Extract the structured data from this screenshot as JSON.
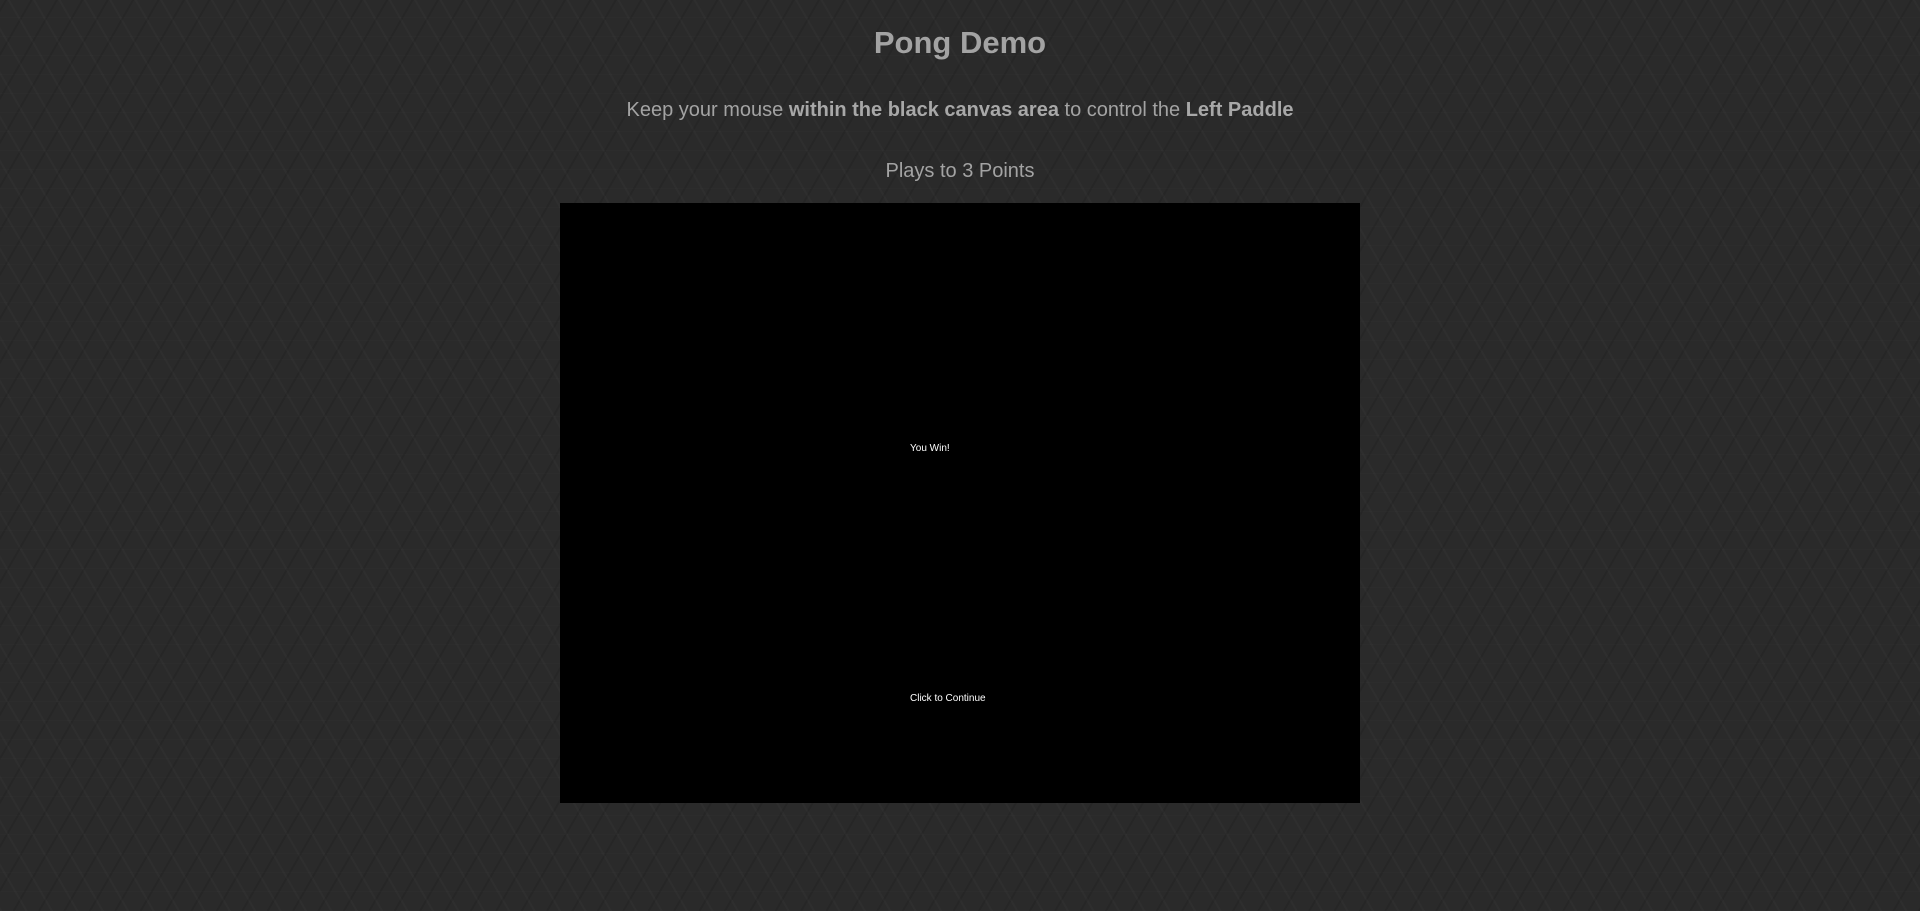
{
  "page": {
    "title": "Pong Demo",
    "instructions": {
      "part1": "Keep your mouse ",
      "emphasis1": "within the black canvas area",
      "part2": " to control the ",
      "emphasis2": "Left Paddle"
    },
    "points_info": "Plays to 3 Points"
  },
  "game": {
    "status_message": "You Win!",
    "prompt_message": "Click to Continue",
    "canvas_color": "#000000",
    "text_color": "#ffffff"
  }
}
